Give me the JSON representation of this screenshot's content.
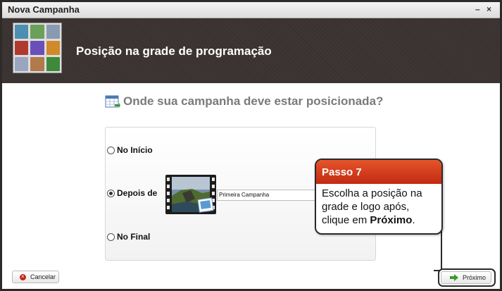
{
  "window": {
    "title": "Nova Campanha",
    "minimize_glyph": "–",
    "close_glyph": "×"
  },
  "header": {
    "title": "Posição na grade de programação",
    "thumb_colors": [
      "#4c8fb0",
      "#6aa05a",
      "#8a9ab0",
      "#b03a2e",
      "#6a4fb8",
      "#d08a2a",
      "#9aa6c0",
      "#b07a4a",
      "#3e8a3a"
    ]
  },
  "question": {
    "text": "Onde sua campanha deve estar posicionada?",
    "icon": "calendar-icon"
  },
  "options": {
    "inicio": {
      "label": "No Início",
      "selected": false
    },
    "depois": {
      "label": "Depois de",
      "selected": true
    },
    "final": {
      "label": "No Final",
      "selected": false
    }
  },
  "campaign_field": {
    "value": "Primeira Campanha"
  },
  "tip": {
    "title": "Passo 7",
    "line1": "Escolha a posição na",
    "line2": "grade e logo após,",
    "line3_prefix": "clique em ",
    "line3_bold": "Próximo",
    "line3_suffix": "."
  },
  "buttons": {
    "cancel": "Cancelar",
    "next": "Próximo"
  },
  "colors": {
    "accent_red": "#c32a12",
    "header_bg": "#3a3230"
  }
}
